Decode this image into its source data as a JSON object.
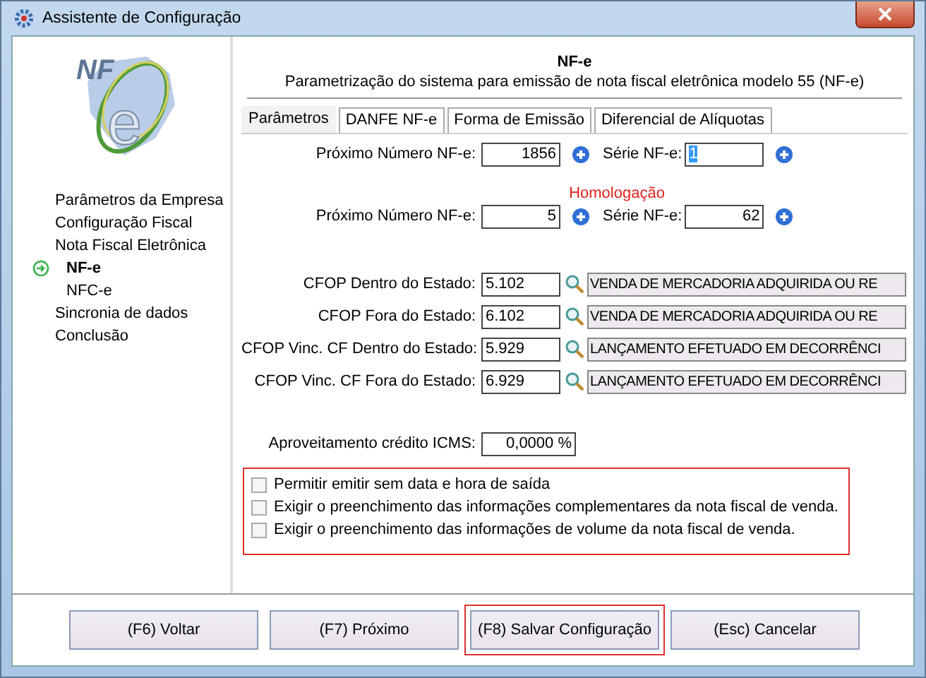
{
  "window": {
    "title": "Assistente de Configuração"
  },
  "logo": {
    "top_text": "NF",
    "letter": "e"
  },
  "sidebar": {
    "items": [
      {
        "label": "Parâmetros da Empresa",
        "selected": false
      },
      {
        "label": "Configuração Fiscal",
        "selected": false
      },
      {
        "label": "Nota Fiscal Eletrônica",
        "selected": false,
        "children": [
          {
            "label": "NF-e",
            "selected": true
          },
          {
            "label": "NFC-e",
            "selected": false
          }
        ]
      },
      {
        "label": "Sincronia de dados",
        "selected": false
      },
      {
        "label": "Conclusão",
        "selected": false
      }
    ]
  },
  "header": {
    "title": "NF-e",
    "subtitle": "Parametrização do sistema para emissão de nota fiscal eletrônica modelo 55 (NF-e)"
  },
  "tabs": [
    {
      "label": "Parâmetros",
      "selected": true
    },
    {
      "label": "DANFE NF-e",
      "selected": false
    },
    {
      "label": "Forma de Emissão",
      "selected": false
    },
    {
      "label": "Diferencial de Alíquotas",
      "selected": false
    }
  ],
  "numbering": [
    {
      "number_label": "Próximo Número NF-e:",
      "number_value": "1856",
      "series_label": "Série NF-e:",
      "series_value": "1",
      "series_text_selected": true
    },
    {
      "heading": "Homologação",
      "number_label": "Próximo Número NF-e:",
      "number_value": "5",
      "series_label": "Série NF-e:",
      "series_value": "62",
      "series_text_selected": false
    }
  ],
  "cfop_rows": [
    {
      "label": "CFOP Dentro do Estado:",
      "code": "5.102",
      "description": "VENDA DE MERCADORIA ADQUIRIDA OU RE"
    },
    {
      "label": "CFOP Fora do Estado:",
      "code": "6.102",
      "description": "VENDA DE MERCADORIA ADQUIRIDA OU RE"
    },
    {
      "label": "CFOP Vinc. CF Dentro do Estado:",
      "code": "5.929",
      "description": "LANÇAMENTO EFETUADO EM DECORRÊNCI"
    },
    {
      "label": "CFOP Vinc. CF Fora do Estado:",
      "code": "6.929",
      "description": "LANÇAMENTO EFETUADO EM DECORRÊNCI"
    }
  ],
  "icms": {
    "label": "Aproveitamento crédito ICMS:",
    "value": "0,0000 %"
  },
  "options": {
    "highlighted": true,
    "items": [
      {
        "label": "Permitir emitir sem data e hora de saída",
        "checked": false
      },
      {
        "label": "Exigir o preenchimento das informações complementares da nota fiscal de venda.",
        "checked": false
      },
      {
        "label": "Exigir o preenchimento das informações de volume da nota fiscal de venda.",
        "checked": false
      }
    ]
  },
  "buttons": [
    {
      "label": "(F6) Voltar",
      "highlighted": false
    },
    {
      "label": "(F7) Próximo",
      "highlighted": false
    },
    {
      "label": "(F8) Salvar Configuração",
      "highlighted": true
    },
    {
      "label": "(Esc) Cancelar",
      "highlighted": false
    }
  ]
}
